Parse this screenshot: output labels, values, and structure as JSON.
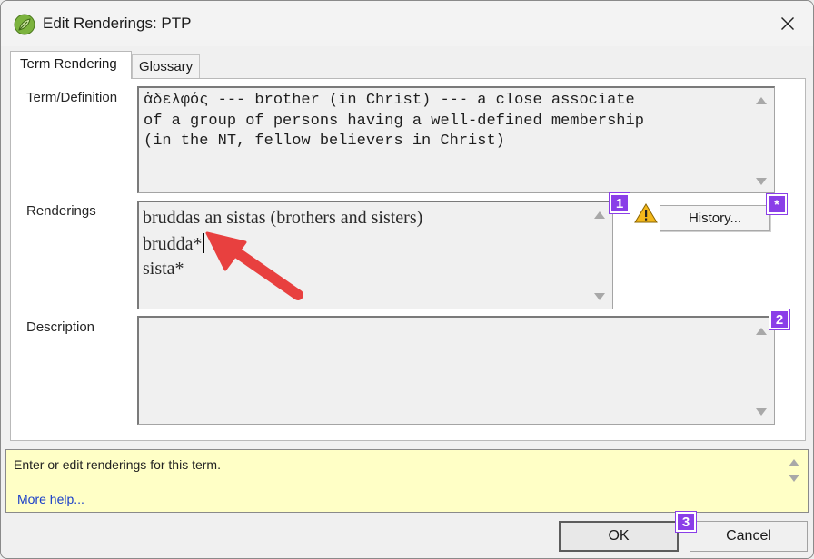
{
  "window": {
    "title": "Edit Renderings: PTP",
    "app_icon": "leaf-icon",
    "close_icon": "close-icon"
  },
  "tabs": [
    {
      "label": "Term Rendering",
      "active": true
    },
    {
      "label": "Glossary",
      "active": false
    }
  ],
  "term": {
    "label": "Term/Definition",
    "lines": [
      "ἀδελφός --- brother (in Christ) --- a close associate",
      "of a group of persons having a well-defined membership",
      "(in the NT, fellow believers in Christ)"
    ]
  },
  "renderings": {
    "label": "Renderings",
    "lines": [
      "bruddas an sistas (brothers and sisters)",
      "brudda*",
      "sista*"
    ],
    "warning_icon": "warning-icon",
    "history_label": "History..."
  },
  "description": {
    "label": "Description",
    "value": ""
  },
  "help": {
    "text": "Enter or edit renderings for this term.",
    "link": "More help..."
  },
  "buttons": {
    "ok": "OK",
    "cancel": "Cancel"
  },
  "callouts": {
    "renderings": "1",
    "history": "*",
    "description": "2",
    "ok": "3"
  },
  "colors": {
    "badge": "#8a3ee8",
    "arrow": "#e8403f",
    "help_bg": "#ffffc6",
    "link": "#1a3fc9"
  }
}
